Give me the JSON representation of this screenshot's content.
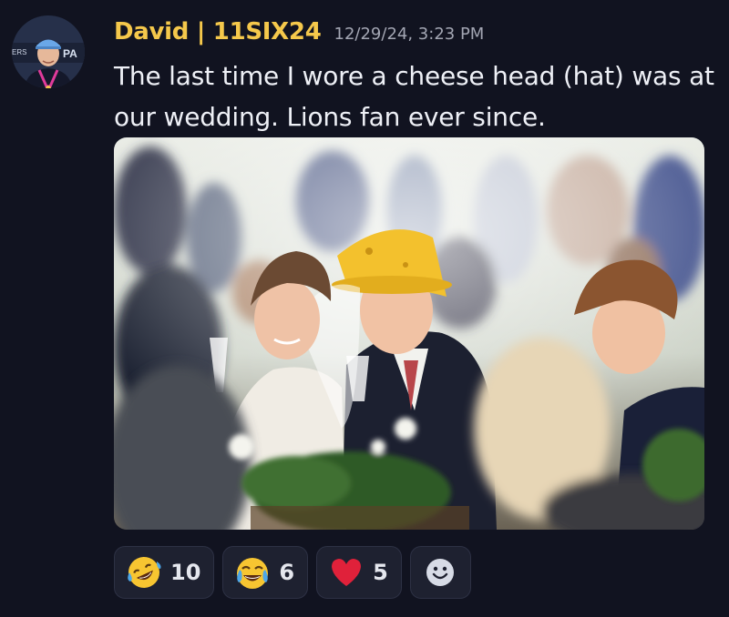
{
  "message": {
    "author": {
      "name": "David | 11SIX24",
      "name_color": "#f5c84b",
      "avatar_icon": "avatar-photo"
    },
    "timestamp": "12/29/24, 3:23 PM",
    "content": "The last time I wore a cheese head (hat) was at our wedding. Lions fan ever since.",
    "attachment": {
      "type": "image",
      "subject": "wedding-reception-photo"
    }
  },
  "reactions": [
    {
      "emoji": "rolling-on-floor-laughing",
      "count": "10"
    },
    {
      "emoji": "face-with-tears-of-joy",
      "count": "6"
    },
    {
      "emoji": "red-heart",
      "count": "5"
    }
  ],
  "add_reaction": {
    "icon": "smiley-add-icon"
  }
}
